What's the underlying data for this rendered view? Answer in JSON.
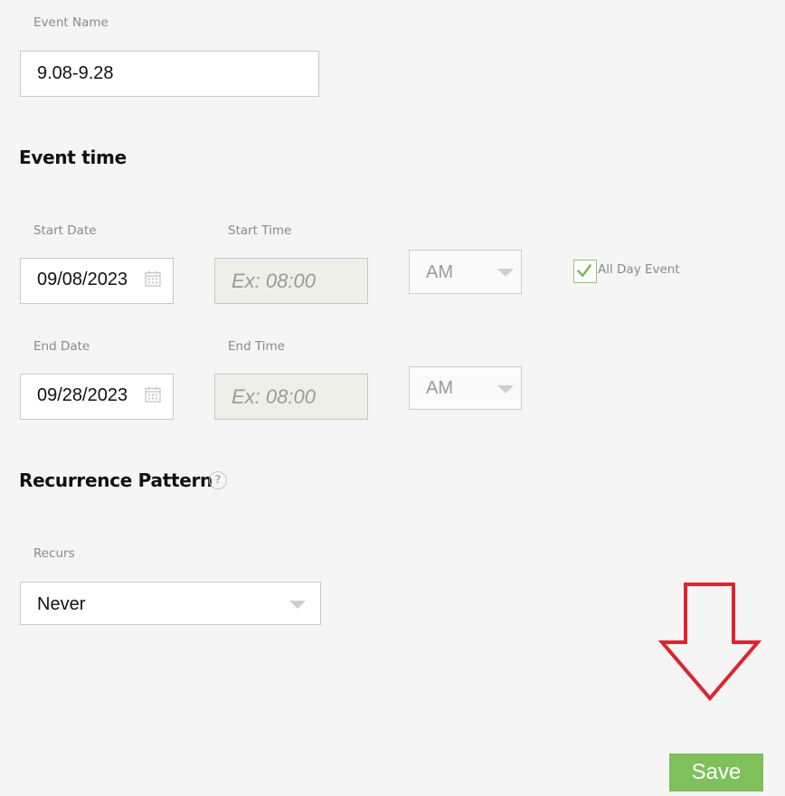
{
  "event_name": {
    "label": "Event Name",
    "value": "9.08-9.28"
  },
  "event_time": {
    "title": "Event time",
    "start_date_label": "Start Date",
    "start_date_value": "09/08/2023",
    "start_time_label": "Start Time",
    "start_time_placeholder": "Ex: 08:00",
    "start_ampm": "AM",
    "end_date_label": "End Date",
    "end_date_value": "09/28/2023",
    "end_time_label": "End Time",
    "end_time_placeholder": "Ex: 08:00",
    "end_ampm": "AM",
    "all_day_label": "All Day Event",
    "all_day_checked": true
  },
  "recurrence": {
    "title": "Recurrence Pattern",
    "help_symbol": "?",
    "recurs_label": "Recurs",
    "recurs_value": "Never"
  },
  "actions": {
    "save_label": "Save"
  },
  "colors": {
    "background": "#f5f5f5",
    "accent_green": "#7ec05a",
    "check_green": "#6fb64b",
    "annotation_red": "#e0232b"
  },
  "icons": {
    "date_picker": "calendar-icon",
    "all_day_check": "checkmark-icon",
    "recurrence_help": "question-circle-icon",
    "annotation": "down-arrow-annotation"
  }
}
